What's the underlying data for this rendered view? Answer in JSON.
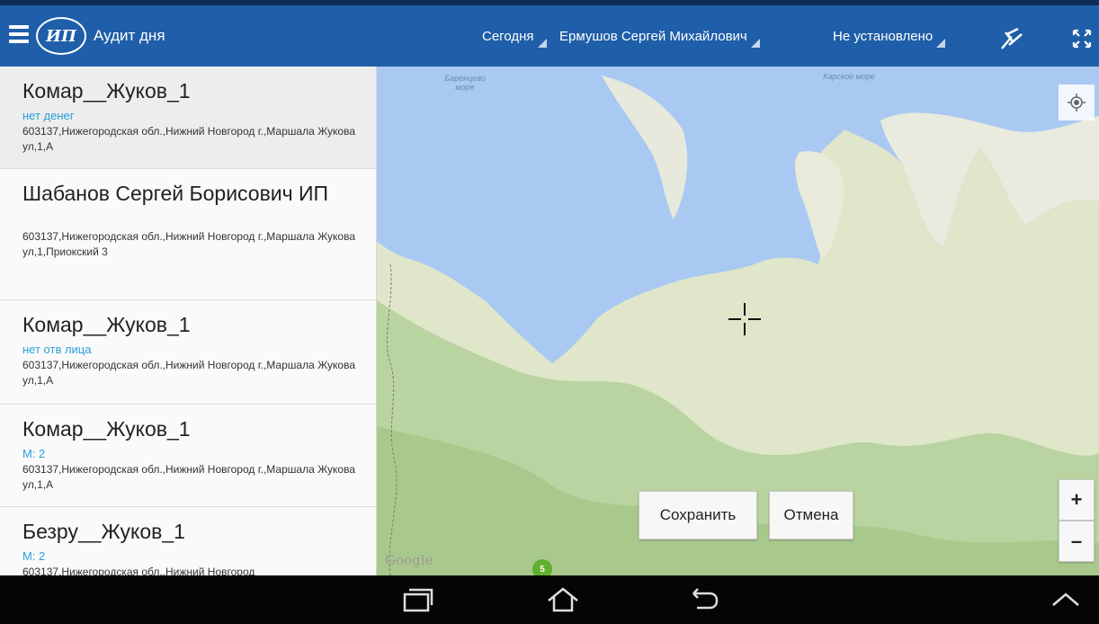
{
  "app": {
    "title": "Аудит дня",
    "logo_text": "ИП",
    "filters": {
      "date": "Сегодня",
      "person": "Ермушов Сергей Михайлович",
      "status": "Не установлено"
    },
    "icons": {
      "menu": "menu-icon",
      "route": "route-icon",
      "fullscreen": "fullscreen-icon"
    },
    "accent_color": "#1f5ea8"
  },
  "list": {
    "items": [
      {
        "name": "Комар__Жуков_1",
        "status": "нет денег",
        "address": "603137,Нижегородская обл.,Нижний Новгород г.,Маршала Жукова ул,1,А"
      },
      {
        "name": "Шабанов Сергей Борисович ИП",
        "status": "",
        "address": "603137,Нижегородская обл.,Нижний Новгород г.,Маршала Жукова ул,1,Приокский 3"
      },
      {
        "name": "Комар__Жуков_1",
        "status": "нет отв лица",
        "address": "603137,Нижегородская обл.,Нижний Новгород г.,Маршала Жукова ул,1,А"
      },
      {
        "name": "Комар__Жуков_1",
        "status": "М: 2",
        "address": "603137,Нижегородская обл.,Нижний Новгород г.,Маршала Жукова ул,1,А"
      },
      {
        "name": "Безру__Жуков_1",
        "status": "М: 2",
        "address": "603137,Нижегородская обл.,Нижний Новгород"
      }
    ]
  },
  "map": {
    "labels": {
      "barents": "Баренцево море",
      "kara": "Карское море",
      "google": "Google"
    },
    "cluster_count": "5",
    "save_label": "Сохранить",
    "cancel_label": "Отмена",
    "zoom_in": "+",
    "zoom_out": "–"
  },
  "navbar": {
    "icons": [
      "recent-apps-icon",
      "home-icon",
      "back-icon",
      "chevron-up-icon"
    ]
  }
}
